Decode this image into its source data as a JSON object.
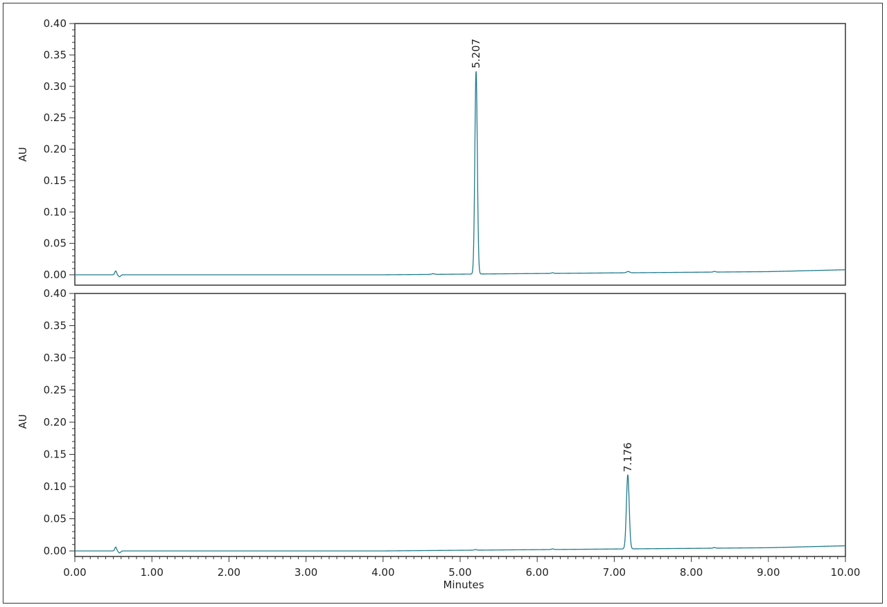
{
  "chart_data": [
    {
      "type": "line",
      "panel": "top",
      "ylabel": "AU",
      "xlabel": "",
      "xlim": [
        0,
        10
      ],
      "ylim": [
        0,
        0.4
      ],
      "y_ticks": [
        "0.00",
        "0.05",
        "0.10",
        "0.15",
        "0.20",
        "0.25",
        "0.30",
        "0.35",
        "0.40"
      ],
      "line_color": "#1f7a8c",
      "peak_label": "5.207",
      "peaks": [
        {
          "t": 5.207,
          "height": 0.323,
          "width": 0.016
        },
        {
          "t": 0.53,
          "height": 0.006,
          "width": 0.012
        },
        {
          "t": 0.58,
          "height": -0.003,
          "width": 0.015
        },
        {
          "t": 4.65,
          "height": 0.001,
          "width": 0.02
        },
        {
          "t": 6.2,
          "height": 0.001,
          "width": 0.015
        },
        {
          "t": 7.18,
          "height": 0.002,
          "width": 0.02
        },
        {
          "t": 8.3,
          "height": 0.001,
          "width": 0.015
        }
      ],
      "baseline": [
        {
          "x": 0.0,
          "y": 0.0
        },
        {
          "x": 4.0,
          "y": 0.0
        },
        {
          "x": 5.0,
          "y": 0.001
        },
        {
          "x": 6.0,
          "y": 0.002
        },
        {
          "x": 7.0,
          "y": 0.003
        },
        {
          "x": 8.0,
          "y": 0.004
        },
        {
          "x": 9.0,
          "y": 0.005
        },
        {
          "x": 10.0,
          "y": 0.008
        }
      ]
    },
    {
      "type": "line",
      "panel": "bottom",
      "ylabel": "AU",
      "xlabel": "Minutes",
      "xlim": [
        0,
        10
      ],
      "ylim": [
        0,
        0.4
      ],
      "x_ticks": [
        "0.00",
        "1.00",
        "2.00",
        "3.00",
        "4.00",
        "5.00",
        "6.00",
        "7.00",
        "8.00",
        "9.00",
        "10.00"
      ],
      "y_ticks": [
        "0.00",
        "0.05",
        "0.10",
        "0.15",
        "0.20",
        "0.25",
        "0.30",
        "0.35",
        "0.40"
      ],
      "line_color": "#1f7a8c",
      "peak_label": "7.176",
      "peaks": [
        {
          "t": 7.176,
          "height": 0.115,
          "width": 0.018
        },
        {
          "t": 0.53,
          "height": 0.006,
          "width": 0.012
        },
        {
          "t": 0.58,
          "height": -0.003,
          "width": 0.015
        },
        {
          "t": 5.2,
          "height": 0.001,
          "width": 0.015
        },
        {
          "t": 6.2,
          "height": 0.001,
          "width": 0.015
        },
        {
          "t": 8.3,
          "height": 0.001,
          "width": 0.015
        }
      ],
      "baseline": [
        {
          "x": 0.0,
          "y": 0.0
        },
        {
          "x": 4.0,
          "y": 0.0
        },
        {
          "x": 5.0,
          "y": 0.001
        },
        {
          "x": 6.0,
          "y": 0.002
        },
        {
          "x": 7.0,
          "y": 0.003
        },
        {
          "x": 8.0,
          "y": 0.004
        },
        {
          "x": 9.0,
          "y": 0.005
        },
        {
          "x": 10.0,
          "y": 0.008
        }
      ]
    }
  ]
}
